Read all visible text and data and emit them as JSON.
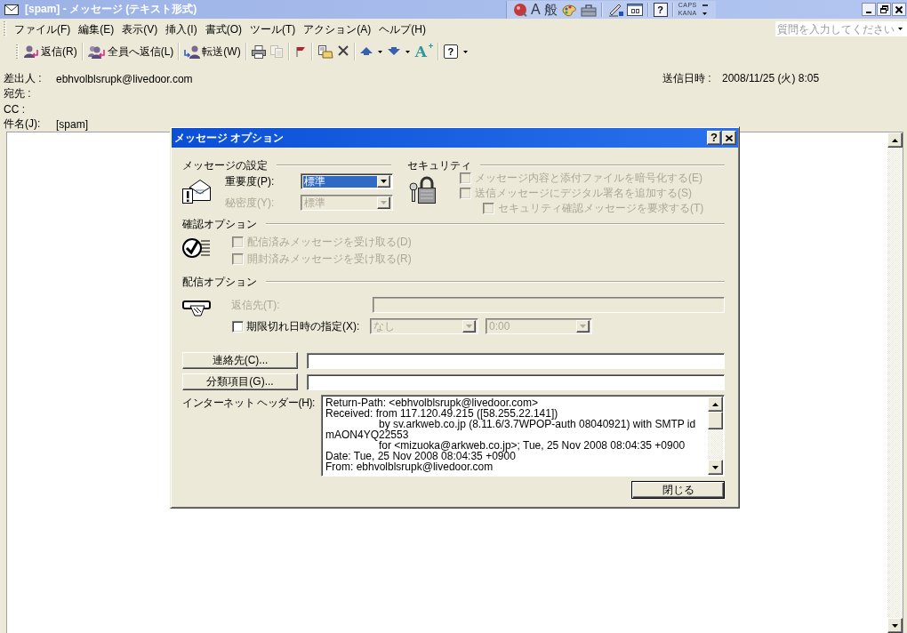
{
  "window": {
    "title": "[spam] - メッセージ (テキスト形式)"
  },
  "language_bar": {
    "input_mode": "A",
    "conversion_mode": "般",
    "help": "?",
    "caps": "CAPS",
    "kana": "KANA"
  },
  "menu_bar": {
    "items": [
      "ファイル(F)",
      "編集(E)",
      "表示(V)",
      "挿入(I)",
      "書式(O)",
      "ツール(T)",
      "アクション(A)",
      "ヘルプ(H)"
    ],
    "help_search": {
      "placeholder": "質問を入力してください"
    }
  },
  "toolbar": {
    "groups": [
      [
        {
          "label": "返信(R)",
          "disabled": false,
          "dropdown": false
        }
      ],
      [
        {
          "label": "全員へ返信(L)",
          "disabled": false,
          "dropdown": false
        }
      ],
      [
        {
          "label": "転送(W)",
          "disabled": false,
          "dropdown": false
        }
      ],
      [
        {
          "disabled": false,
          "dropdown": false
        },
        {
          "disabled": true,
          "dropdown": false
        }
      ],
      [
        {
          "disabled": false,
          "dropdown": false
        }
      ],
      [
        {
          "disabled": false,
          "dropdown": false
        },
        {
          "disabled": false,
          "dropdown": false
        }
      ],
      [
        {
          "disabled": false,
          "dropdown": true
        },
        {
          "disabled": false,
          "dropdown": true
        },
        {
          "glyph": "A",
          "disabled": false,
          "dropdown": false
        }
      ],
      [
        {
          "glyph": "?",
          "disabled": false,
          "dropdown": true
        }
      ]
    ]
  },
  "header": {
    "fields": [
      {
        "label": "差出人 :",
        "value": "ebhvolblsrupk@livedoor.com"
      },
      {
        "label": "宛先 :"
      },
      {
        "label": "CC :"
      },
      {
        "label": "件名(J):",
        "value": "[spam]"
      }
    ],
    "sent": {
      "label": "送信日時 :",
      "value": "2008/11/25 (火) 8:05"
    }
  },
  "dialog": {
    "title": "メッセージ オプション",
    "help_button": "?",
    "message_settings": {
      "heading": "メッセージの設定",
      "fields": [
        {
          "label": "重要度(P):",
          "value": "標準",
          "disabled": false,
          "focused": true
        },
        {
          "label": "秘密度(Y):",
          "value": "標準",
          "disabled": true,
          "focused": false
        }
      ]
    },
    "security": {
      "heading": "セキュリティ",
      "options": [
        {
          "label": "メッセージ内容と添付ファイルを暗号化する(E)",
          "checked": false,
          "disabled": true
        },
        {
          "label": "送信メッセージにデジタル署名を追加する(S)",
          "checked": false,
          "disabled": true,
          "children": [
            {
              "label": "セキュリティ確認メッセージを要求する(T)",
              "checked": false,
              "disabled": true
            }
          ]
        }
      ]
    },
    "tracking_options": {
      "heading": "確認オプション",
      "options": [
        {
          "label": "配信済みメッセージを受け取る(D)",
          "checked": false,
          "disabled": true
        },
        {
          "label": "開封済みメッセージを受け取る(R)",
          "checked": false,
          "disabled": true
        }
      ]
    },
    "delivery_options": {
      "heading": "配信オプション",
      "reply_to": {
        "label": "返信先(T):",
        "disabled": true
      },
      "expiry": {
        "label": "期限切れ日時の指定(X):",
        "checked": false,
        "disabled": false,
        "date": {
          "value": "なし",
          "disabled": true
        },
        "time": {
          "value": "0:00",
          "disabled": true
        }
      }
    },
    "contacts": {
      "button": "連絡先(C)..."
    },
    "categories": {
      "button": "分類項目(G)..."
    },
    "internet_headers": {
      "label": "インターネット ヘッダー(H):",
      "lines": [
        "Return-Path: <ebhvolblsrupk@livedoor.com>",
        "Received: from 117.120.49.215 ([58.255.22.141])",
        "\tby sv.arkweb.co.jp (8.11.6/3.7WPOP-auth 08040921) with SMTP id",
        "mAON4YQ22553",
        "\tfor <mizuoka@arkweb.co.jp>; Tue, 25 Nov 2008 08:04:35 +0900",
        "Date: Tue, 25 Nov 2008 08:04:35 +0900",
        "From: ebhvolblsrupk@livedoor.com"
      ]
    },
    "close_button": "閉じる"
  }
}
